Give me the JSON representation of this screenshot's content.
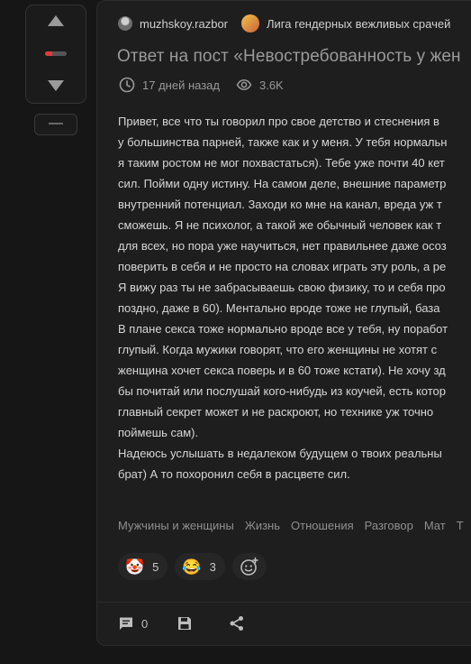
{
  "vote": {
    "up_icon": "arrow-up-icon",
    "down_icon": "arrow-down-icon",
    "rating_negative_fraction": 0.35,
    "rating_negative_color": "#e03a3a",
    "collapse_label": "—"
  },
  "post": {
    "author": "muzhskoy.razbor",
    "community": "Лига гендерных вежливых срачей",
    "title": "Ответ на пост «Невостребованность у жен",
    "time": "17 дней назад",
    "views": "3.6K",
    "body_lines": [
      "Привет, все что ты говорил про свое детство и стеснения в",
      "у большинства парней, также как и у меня. У тебя нормальн",
      "я таким ростом не мог похвастаться). Тебе уже почти 40 кет",
      "сил. Пойми одну истину. На самом деле, внешние параметр",
      "внутренний потенциал. Заходи ко мне на канал, вреда уж т",
      "сможешь. Я не психолог, а такой же обычный человек как т",
      "для всех, но пора уже научиться, нет правильнее даже осоз",
      "поверить в себя и не просто на словах играть эту роль, а ре",
      "Я вижу раз ты не забрасываешь свою физику, то и себя про",
      "поздно, даже в 60). Ментально вроде тоже не глупый, база",
      "В плане секса тоже нормально вроде все у тебя, ну поработ",
      "глупый. Когда мужики говорят, что его женщины не хотят с",
      "женщина хочет секса поверь и в 60 тоже кстати). Не хочу зд",
      "бы почитай или послушай кого-нибудь из коучей, есть котор",
      "главный секрет может и не раскроют, но технике уж точно",
      "поймешь сам).",
      "Надеюсь услышать в недалеком будущем о твоих реальны",
      "брат) А то похоронил себя в расцвете сил."
    ],
    "tags": [
      "Мужчины и женщины",
      "Жизнь",
      "Отношения",
      "Разговор",
      "Мат",
      "Т"
    ],
    "reactions": [
      {
        "emoji": "🤡",
        "icon": "clown-face-icon",
        "count": "5"
      },
      {
        "emoji": "😂",
        "icon": "laughing-face-icon",
        "count": "3"
      }
    ],
    "add_reaction_icon": "add-emoji-icon",
    "comments_count": "0"
  }
}
